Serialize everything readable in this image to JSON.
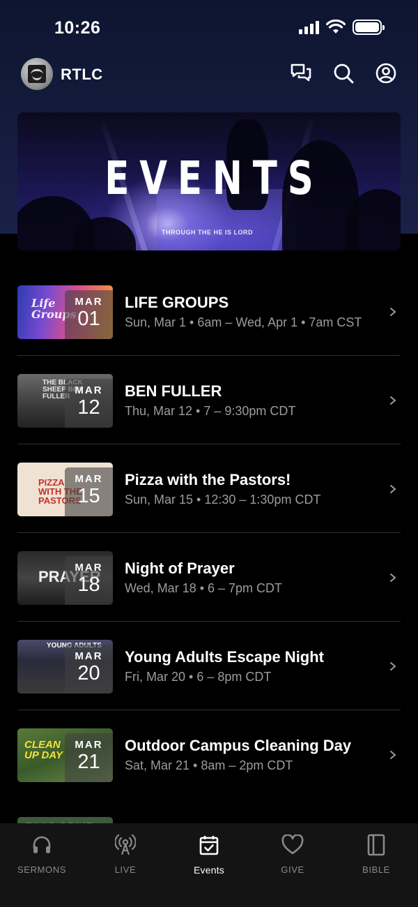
{
  "status_bar": {
    "time": "10:26"
  },
  "header": {
    "app_name": "RTLC"
  },
  "hero": {
    "title": "EVENTS",
    "caption": "THROUGH THE      HE IS LORD"
  },
  "events": [
    {
      "title": "LIFE GROUPS",
      "subtitle": "Sun, Mar 1 • 6am – Wed, Apr 1 • 7am CST",
      "month": "MAR",
      "day": "01",
      "thumb_text": "Life Groups"
    },
    {
      "title": "BEN FULLER",
      "subtitle": "Thu, Mar 12 • 7 – 9:30pm CDT",
      "month": "MAR",
      "day": "12",
      "thumb_text": "THE BLACK SHEEP BEN FULLER"
    },
    {
      "title": "Pizza with the Pastors!",
      "subtitle": "Sun, Mar 15 • 12:30 – 1:30pm CDT",
      "month": "MAR",
      "day": "15",
      "thumb_text": "PIZZA WITH THE PASTORS"
    },
    {
      "title": "Night of Prayer",
      "subtitle": "Wed, Mar 18 • 6 – 7pm CDT",
      "month": "MAR",
      "day": "18",
      "thumb_text": "PRAYER"
    },
    {
      "title": "Young Adults Escape Night",
      "subtitle": "Fri, Mar 20 • 6 – 8pm CDT",
      "month": "MAR",
      "day": "20",
      "thumb_text": "YOUNG ADULTS"
    },
    {
      "title": "Outdoor Campus Cleaning Day",
      "subtitle": "Sat, Mar 21 • 8am – 2pm CDT",
      "month": "MAR",
      "day": "21",
      "thumb_text": "CLEAN UP DAY"
    }
  ],
  "partial_event": {
    "thumb_text": "FOOD DRIVE"
  },
  "tabs": [
    {
      "label": "SERMONS",
      "icon": "headphones-icon",
      "active": false
    },
    {
      "label": "LIVE",
      "icon": "broadcast-icon",
      "active": false
    },
    {
      "label": "Events",
      "icon": "calendar-check-icon",
      "active": true
    },
    {
      "label": "GIVE",
      "icon": "heart-icon",
      "active": false
    },
    {
      "label": "BIBLE",
      "icon": "book-icon",
      "active": false
    }
  ],
  "colors": {
    "background": "#000000",
    "header_gradient_top": "#0e1530",
    "header_gradient_bottom": "#1a2147",
    "tab_bar": "#141414",
    "subtitle_text": "#9c9c9c",
    "divider": "#2f2f2f",
    "tab_inactive": "#8a8a8a"
  }
}
